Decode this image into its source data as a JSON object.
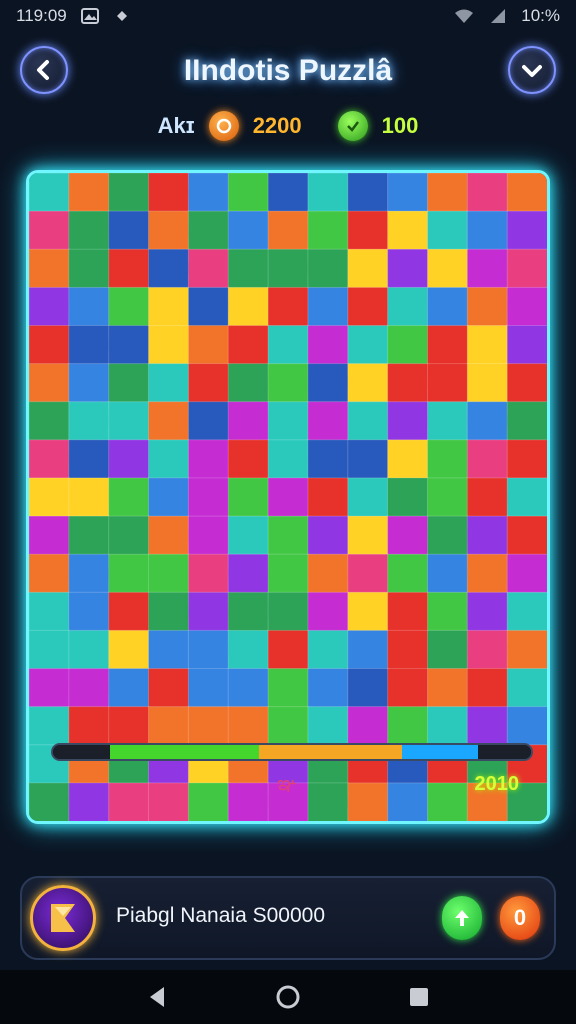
{
  "status_bar": {
    "time": "119:09",
    "battery": "10:%"
  },
  "header": {
    "title": "IIndotis Puzzlâ"
  },
  "currency": {
    "label": "Akɪ",
    "coins": "2200",
    "gems": "100",
    "coin_color": "#f38b22",
    "gem_color": "#49c92c"
  },
  "board": {
    "grid": {
      "rows": 17,
      "cols": 13
    },
    "palette": [
      "#e6261f",
      "#f26b1d",
      "#ffd018",
      "#37c43a",
      "#1f9e4c",
      "#1ec6b8",
      "#2a7de1",
      "#1b4fb8",
      "#8a2be2",
      "#c21fd0",
      "#e8337a"
    ],
    "progress": {
      "segments": [
        {
          "color": "#1b1f2a",
          "fraction": 0.12
        },
        {
          "color": "#44d62c",
          "fraction": 0.31
        },
        {
          "color": "#f5a623",
          "fraction": 0.3
        },
        {
          "color": "#1aa7ff",
          "fraction": 0.16
        },
        {
          "color": "#1b1f2a",
          "fraction": 0.11
        }
      ]
    },
    "score": "2010",
    "mark": "ఞ"
  },
  "player": {
    "name": "Piabgl Nanaia S00000"
  },
  "actions": {
    "up_icon": "arrow-up-icon",
    "zero_label": "0"
  }
}
